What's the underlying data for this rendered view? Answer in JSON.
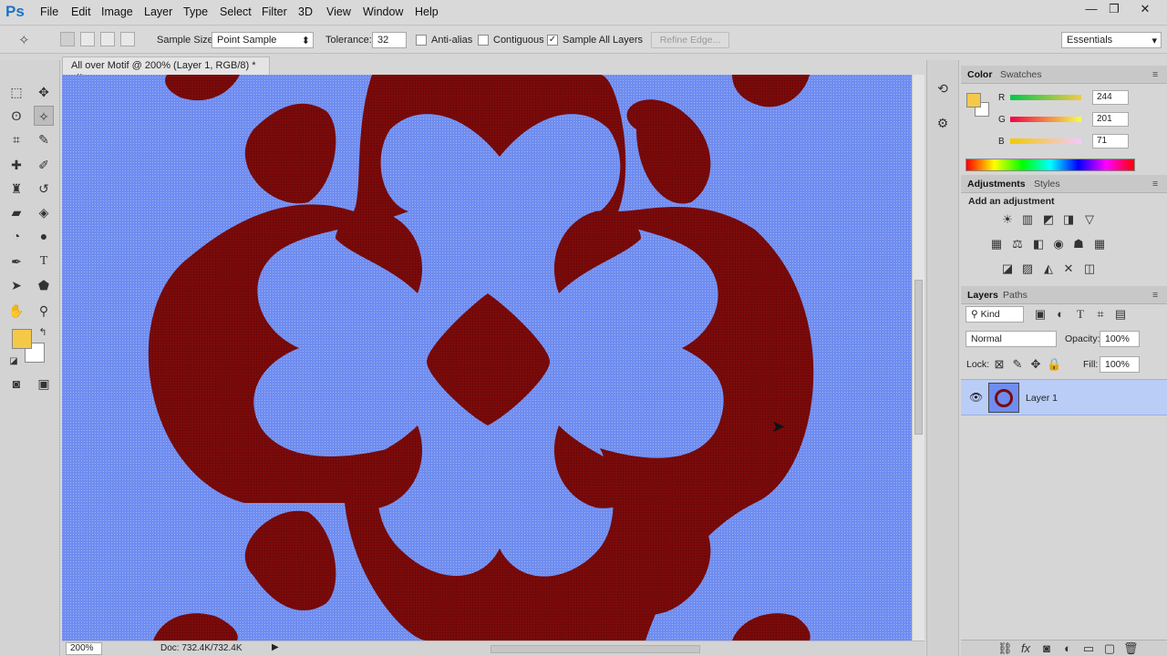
{
  "app": {
    "logo": "Ps"
  },
  "menu": [
    "File",
    "Edit",
    "Image",
    "Layer",
    "Type",
    "Select",
    "Filter",
    "3D",
    "View",
    "Window",
    "Help"
  ],
  "window_controls": {
    "minimize": "—",
    "restore": "❐",
    "close": "✕"
  },
  "options": {
    "sample_size_label": "Sample Size:",
    "sample_size_value": "Point Sample",
    "tolerance_label": "Tolerance:",
    "tolerance_value": "32",
    "anti_alias_label": "Anti-alias",
    "contiguous_label": "Contiguous",
    "sample_all_layers_label": "Sample All Layers",
    "sample_all_layers_checked": "✓",
    "refine_edge_label": "Refine Edge...",
    "workspace": "Essentials"
  },
  "document": {
    "tab_title": "All over Motif @ 200% (Layer 1, RGB/8) *",
    "tab_close": "×",
    "zoom": "200%",
    "doc_info": "Doc: 732.4K/732.4K",
    "background_color": "#6f8df0",
    "motif_color": "#7a0a0a"
  },
  "colors": {
    "foreground": "#f4c947",
    "background": "#ffffff"
  },
  "color_panel": {
    "tabs": [
      "Color",
      "Swatches"
    ],
    "r_label": "R",
    "r_value": "244",
    "g_label": "G",
    "g_value": "201",
    "b_label": "B",
    "b_value": "71"
  },
  "adjustments_panel": {
    "tabs": [
      "Adjustments",
      "Styles"
    ],
    "heading": "Add an adjustment"
  },
  "layers_panel": {
    "tabs": [
      "Layers",
      "Paths"
    ],
    "filter_kind": "Kind",
    "blend_mode": "Normal",
    "opacity_label": "Opacity:",
    "opacity_value": "100%",
    "lock_label": "Lock:",
    "fill_label": "Fill:",
    "fill_value": "100%",
    "layers": [
      {
        "name": "Layer 1",
        "visible_icon": "eye-icon",
        "selected": true
      }
    ]
  }
}
